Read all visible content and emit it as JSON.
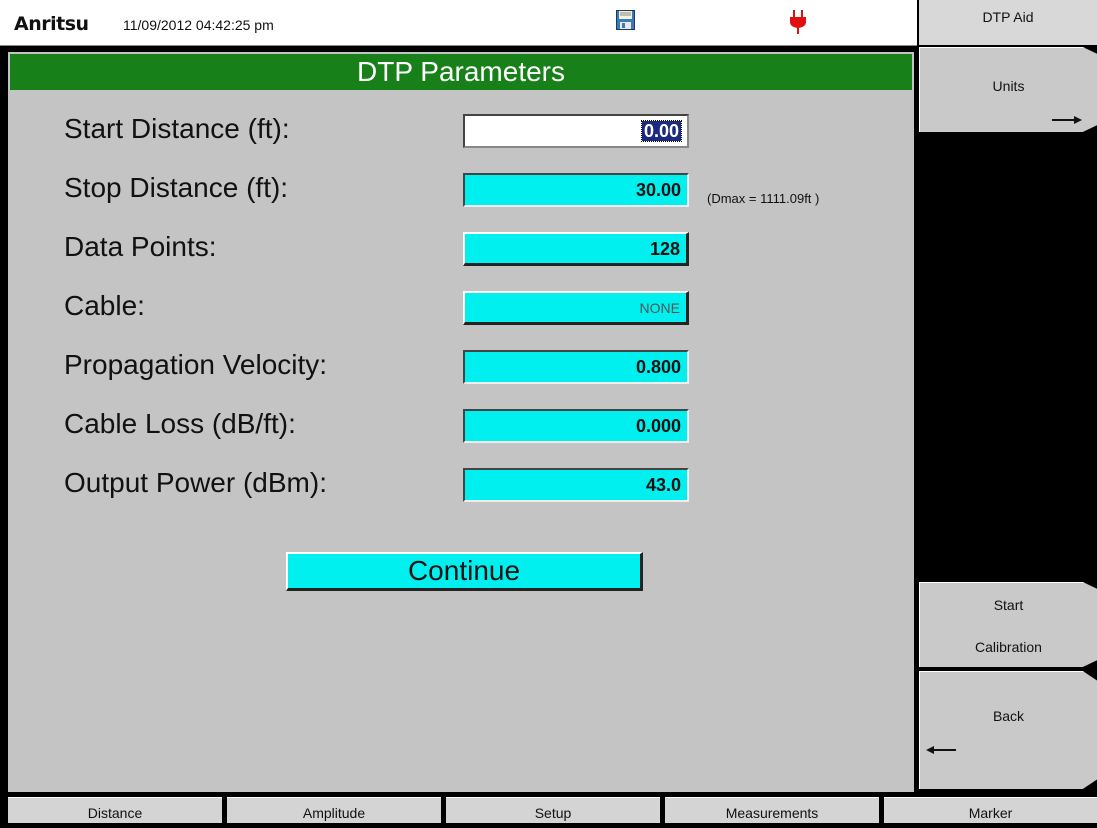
{
  "status": {
    "brand": "Anritsu",
    "datetime": "11/09/2012 04:42:25 pm",
    "save_icon": "floppy-disk-icon",
    "power_icon": "power-plug-icon"
  },
  "panel": {
    "title": "DTP Parameters",
    "fields": [
      {
        "label": "Start Distance (ft):",
        "value": "0.00"
      },
      {
        "label": "Stop Distance (ft):",
        "value": "30.00"
      },
      {
        "label": "Data Points:",
        "value": "128"
      },
      {
        "label": "Cable:",
        "value": "NONE"
      },
      {
        "label": "Propagation Velocity:",
        "value": "0.800"
      },
      {
        "label": "Cable Loss (dB/ft):",
        "value": "0.000"
      },
      {
        "label": "Output Power (dBm):",
        "value": "43.0"
      }
    ],
    "dmax_note": "(Dmax = 1111.09ft )",
    "continue_label": "Continue"
  },
  "softkeys": {
    "title": "DTP Aid",
    "units": "Units",
    "start_line1": "Start",
    "start_line2": "Calibration",
    "back": "Back"
  },
  "bottom_tabs": [
    "Distance",
    "Amplitude",
    "Setup",
    "Measurements",
    "Marker"
  ],
  "colors": {
    "title_bar": "#188018",
    "field": "#00f0f0",
    "panel": "#c4c4c4"
  }
}
